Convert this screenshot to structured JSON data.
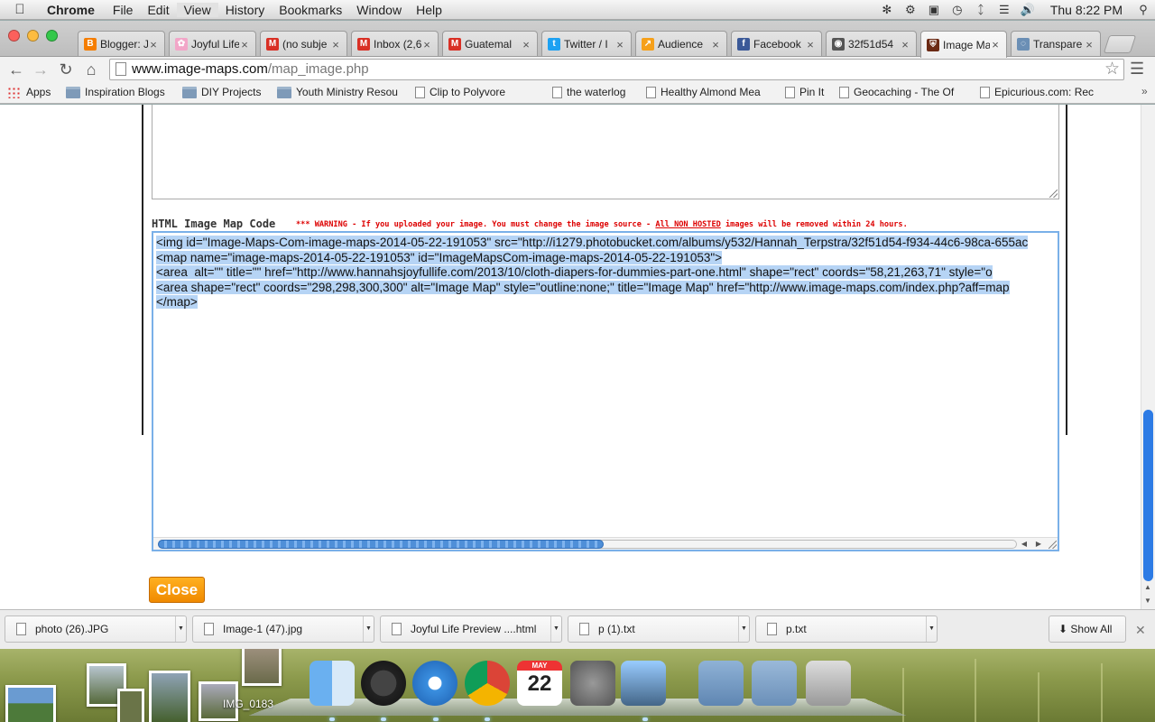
{
  "menubar": {
    "app": "Chrome",
    "items": [
      "File",
      "Edit",
      "View",
      "History",
      "Bookmarks",
      "Window",
      "Help"
    ],
    "active": "View",
    "clock": "Thu 8:22 PM"
  },
  "tabs": [
    {
      "title": "Blogger: J",
      "icon": "blogger-icon",
      "color": "#f57d00"
    },
    {
      "title": "Joyful Life",
      "icon": "flower-icon",
      "color": "#f2a6c8"
    },
    {
      "title": "(no subje",
      "icon": "gmail-icon",
      "color": "#d93025"
    },
    {
      "title": "Inbox (2,6",
      "icon": "gmail-icon",
      "color": "#d93025"
    },
    {
      "title": "Guatemal",
      "icon": "gmail-icon",
      "color": "#d93025"
    },
    {
      "title": "Twitter / I",
      "icon": "twitter-icon",
      "color": "#1da1f2"
    },
    {
      "title": "Audience",
      "icon": "analytics-icon",
      "color": "#f6a01a"
    },
    {
      "title": "Facebook",
      "icon": "facebook-icon",
      "color": "#3b5998"
    },
    {
      "title": "32f51d54",
      "icon": "camera-icon",
      "color": "#555555"
    },
    {
      "title": "Image Ma",
      "icon": "shield-icon",
      "color": "#6b2a14"
    },
    {
      "title": "Transpare",
      "icon": "loading-icon",
      "color": "#6b8fb5"
    }
  ],
  "toolbar": {
    "url_host": "www.image-maps.com",
    "url_path": "/map_image.php"
  },
  "bookmarks": [
    {
      "label": "Apps",
      "type": "apps"
    },
    {
      "label": "Inspiration Blogs",
      "type": "folder"
    },
    {
      "label": "DIY Projects",
      "type": "folder"
    },
    {
      "label": "Youth Ministry Resou",
      "type": "folder"
    },
    {
      "label": "Clip to Polyvore",
      "type": "page"
    },
    {
      "label": "the waterlog",
      "type": "page"
    },
    {
      "label": "Healthy Almond Mea",
      "type": "page"
    },
    {
      "label": "Pin It",
      "type": "page"
    },
    {
      "label": "Geocaching - The Of",
      "type": "page"
    },
    {
      "label": "Epicurious.com: Rec",
      "type": "page"
    }
  ],
  "modal": {
    "code_label": "HTML Image Map Code",
    "warning_prefix": "*** WARNING - If you uploaded your image. You must change the image source - ",
    "warning_underlined": "All NON HOSTED",
    "warning_suffix": " images will be removed within 24 hours.",
    "code_lines": [
      "<img id=\"Image-Maps-Com-image-maps-2014-05-22-191053\" src=\"http://i1279.photobucket.com/albums/y532/Hannah_Terpstra/32f51d54-f934-44c6-98ca-655ac",
      "<map name=\"image-maps-2014-05-22-191053\" id=\"ImageMapsCom-image-maps-2014-05-22-191053\">",
      "<area  alt=\"\" title=\"\" href=\"http://www.hannahsjoyfullife.com/2013/10/cloth-diapers-for-dummies-part-one.html\" shape=\"rect\" coords=\"58,21,263,71\" style=\"o",
      "<area shape=\"rect\" coords=\"298,298,300,300\" alt=\"Image Map\" style=\"outline:none;\" title=\"Image Map\" href=\"http://www.image-maps.com/index.php?aff=map",
      "</map>"
    ],
    "close_label": "Close"
  },
  "downloads": [
    {
      "name": "photo (26).JPG"
    },
    {
      "name": "Image-1 (47).jpg"
    },
    {
      "name": "Joyful Life   Preview   ....html"
    },
    {
      "name": "p (1).txt"
    },
    {
      "name": "p.txt"
    }
  ],
  "downloads_show_all": "Show All",
  "desktop": {
    "image_label": "IMG_0183"
  },
  "dock": [
    {
      "icon": "finder-icon"
    },
    {
      "icon": "dashboard-icon"
    },
    {
      "icon": "safari-icon"
    },
    {
      "icon": "chrome-icon"
    },
    {
      "icon": "calendar-icon",
      "text": "22",
      "month": "MAY"
    },
    {
      "icon": "system-preferences-icon"
    },
    {
      "icon": "iphoto-icon"
    },
    {
      "icon": "applications-folder-icon"
    },
    {
      "icon": "documents-folder-icon"
    },
    {
      "icon": "trash-icon"
    }
  ]
}
